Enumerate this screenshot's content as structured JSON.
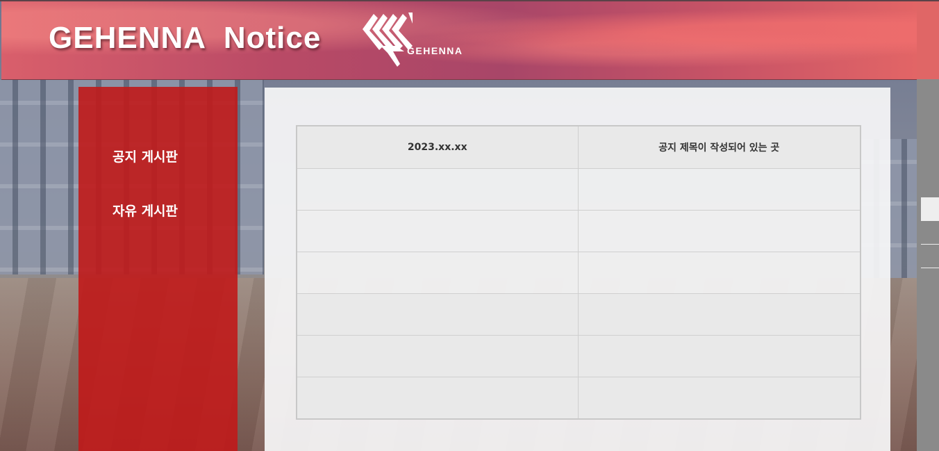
{
  "header": {
    "title": "GEHENNA  Notice",
    "logo_text": "GEHENNA",
    "logo_icon": "gehenna-emblem-icon"
  },
  "sidebar": {
    "items": [
      {
        "label": "공지 게시판"
      },
      {
        "label": "자유 게시판"
      }
    ]
  },
  "notice_table": {
    "header": {
      "date": "2023.xx.xx",
      "title": "공지 제목이 작성되어 있는 곳"
    },
    "rows": [
      {
        "date": "",
        "title": ""
      },
      {
        "date": "",
        "title": ""
      },
      {
        "date": "",
        "title": ""
      },
      {
        "date": "",
        "title": ""
      },
      {
        "date": "",
        "title": ""
      },
      {
        "date": "",
        "title": ""
      }
    ]
  },
  "colors": {
    "header": "#b94a66",
    "sidebar": "#c01919",
    "panel": "#f6f6f7"
  }
}
